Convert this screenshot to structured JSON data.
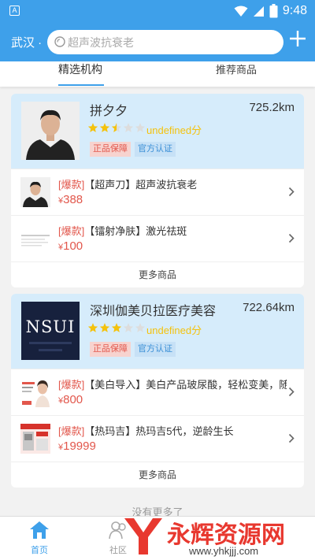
{
  "status_bar": {
    "app_icon_letter": "A",
    "time": "9:48",
    "battery_level": "8"
  },
  "header": {
    "city": "武汉 ·",
    "search_placeholder": "超声波抗衰老"
  },
  "tabs": [
    {
      "label": "精选机构",
      "active": true
    },
    {
      "label": "推荐商品",
      "active": false
    }
  ],
  "institutions": [
    {
      "name": "拼夕夕",
      "distance": "725.2km",
      "rating": 2.5,
      "score_text": "undefined分",
      "badges": [
        "正品保障",
        "官方认证"
      ],
      "products": [
        {
          "tag": "[爆款]",
          "title": "【超声刀】超声波抗衰老",
          "currency": "¥",
          "price": "388"
        },
        {
          "tag": "[爆款]",
          "title": "【镭射净肤】激光祛斑",
          "currency": "¥",
          "price": "100"
        }
      ],
      "more_label": "更多商品"
    },
    {
      "name": "深圳伽美贝拉医疗美容",
      "distance": "722.64km",
      "rating": 3,
      "score_text": "undefined分",
      "logo_text": "NSUI",
      "badges": [
        "正品保障",
        "官方认证"
      ],
      "products": [
        {
          "tag": "[爆款]",
          "title": "【美白导入】美白产品玻尿酸，轻松变美，随...",
          "currency": "¥",
          "price": "800"
        },
        {
          "tag": "[爆款]",
          "title": "【热玛吉】热玛吉5代，逆龄生长",
          "currency": "¥",
          "price": "19999"
        }
      ],
      "more_label": "更多商品"
    }
  ],
  "list_footer": "没有更多了",
  "bottom_nav": [
    {
      "label": "首页",
      "icon": "home-icon",
      "active": true
    },
    {
      "label": "社区",
      "icon": "community-icon",
      "active": false
    }
  ],
  "watermark": {
    "brand": "永辉资源网",
    "url": "www.yhkjjj.com"
  },
  "colors": {
    "primary": "#3ea0ea",
    "price": "#e2574c",
    "star": "#f4c20d",
    "card_head": "#d6ecfb"
  }
}
